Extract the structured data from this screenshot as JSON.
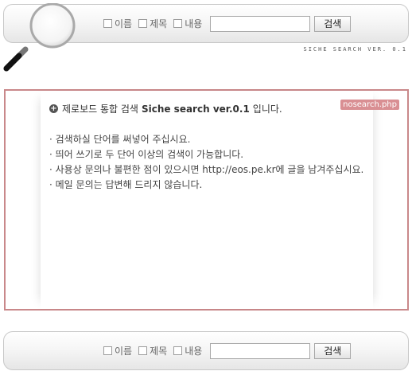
{
  "search_top": {
    "options": [
      {
        "label": "이름"
      },
      {
        "label": "제목"
      },
      {
        "label": "내용"
      }
    ],
    "input_value": "",
    "button_label": "검색"
  },
  "version_text": "SICHE SEARCH VER. 0.1",
  "content": {
    "headline_prefix": "제로보드 통합 검색",
    "headline_strong": "Siche search ver.0.1",
    "headline_suffix": "입니다.",
    "file_tag": "nosearch.php",
    "notes": [
      "· 검색하실 단어를 써넣어 주십시요.",
      "· 띄어 쓰기로 두 단어 이상의 검색이 가능합니다.",
      "· 사용상 문의나 불편한 점이 있으시면 http://eos.pe.kr에 글을 남겨주십시요.",
      "· 메일 문의는 답변해 드리지 않습니다."
    ]
  },
  "search_bottom": {
    "options": [
      {
        "label": "이름"
      },
      {
        "label": "제목"
      },
      {
        "label": "내용"
      }
    ],
    "input_value": "",
    "button_label": "검색"
  },
  "colors": {
    "frame_border": "#c9888a",
    "tag_bg": "#d98f93"
  }
}
